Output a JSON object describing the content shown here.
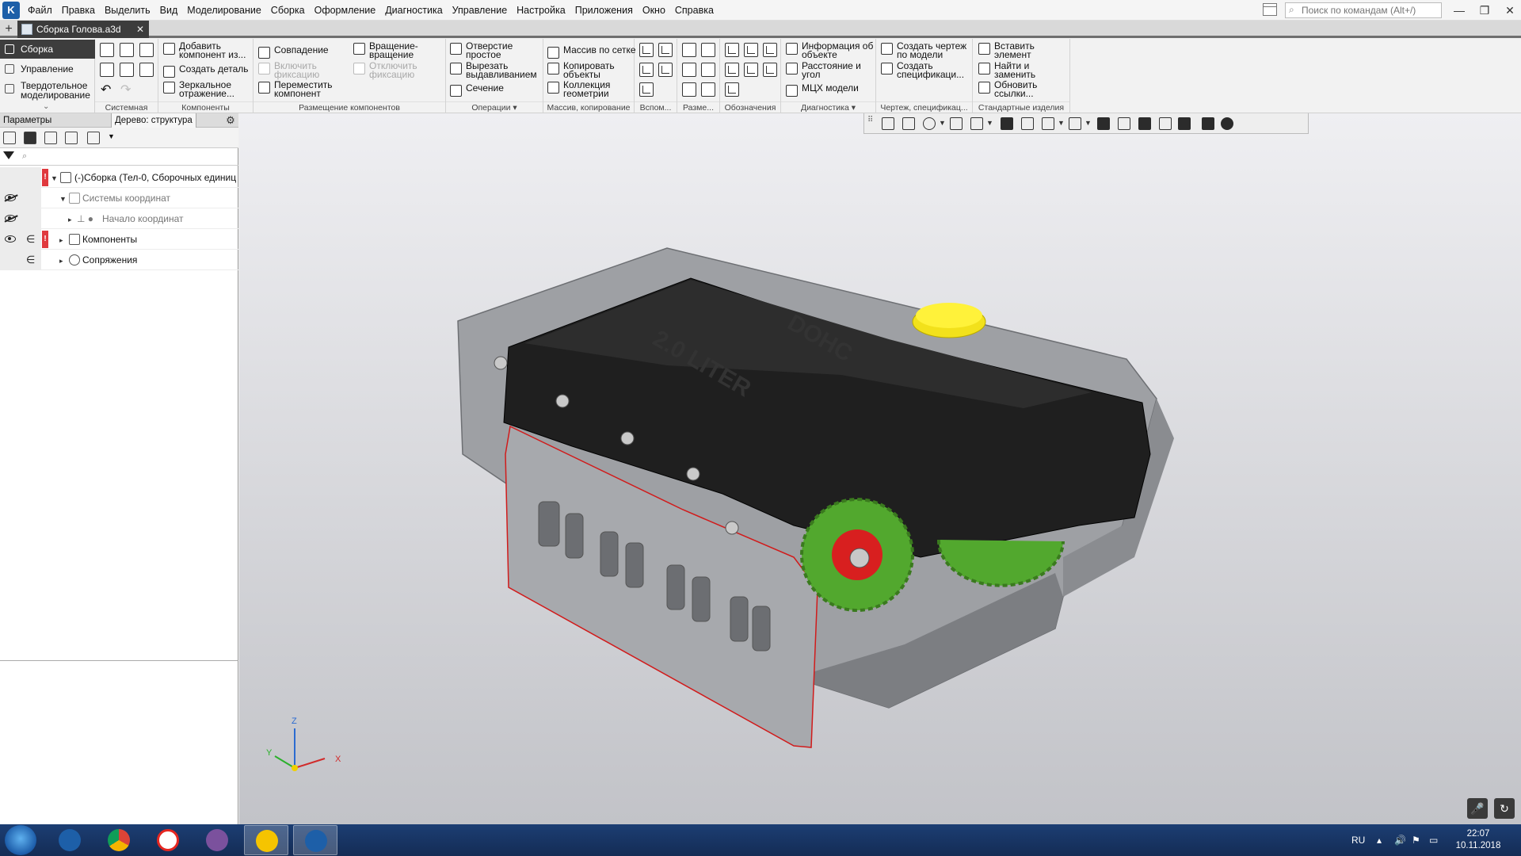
{
  "app": {
    "menu": [
      "Файл",
      "Правка",
      "Выделить",
      "Вид",
      "Моделирование",
      "Сборка",
      "Оформление",
      "Диагностика",
      "Управление",
      "Настройка",
      "Приложения",
      "Окно",
      "Справка"
    ],
    "search_placeholder": "Поиск по командам (Alt+/)"
  },
  "tabs": {
    "doc_title": "Сборка Голова.a3d"
  },
  "ribbon": {
    "modes": [
      "Сборка",
      "Управление",
      "Твердотельное моделирование"
    ],
    "groups": {
      "system": "Системная",
      "components": "Компоненты",
      "placement": "Размещение компонентов",
      "operations": "Операции",
      "array": "Массив, копирование",
      "aux": "Вспом...",
      "dims": "Разме...",
      "notation": "Обозначения",
      "diagnostics": "Диагностика",
      "drawing": "Чертеж, спецификац...",
      "standard": "Стандартные изделия"
    },
    "buttons": {
      "add_component": "Добавить компонент из...",
      "create_part": "Создать деталь",
      "mirror": "Зеркальное отражение...",
      "coincidence": "Совпадение",
      "enable_fix": "Включить фиксацию",
      "move_component": "Переместить компонент",
      "rotate_move": "Вращение-вращение",
      "disable_fix": "Отключить фиксацию",
      "simple_hole": "Отверстие простое",
      "cut_extrude": "Вырезать выдавливанием",
      "section": "Сечение",
      "grid_array": "Массив по сетке",
      "copy_objects": "Копировать объекты",
      "geom_collection": "Коллекция геометрии",
      "object_info": "Информация об объекте",
      "distance_angle": "Расстояние и угол",
      "mass_props": "МЦХ модели",
      "create_drawing": "Создать чертеж по модели",
      "create_spec": "Создать спецификаци...",
      "insert_element": "Вставить элемент",
      "find_replace": "Найти и заменить",
      "update_links": "Обновить ссылки..."
    }
  },
  "left_panel": {
    "tab_params": "Параметры",
    "tab_tree": "Дерево: структура",
    "tree": [
      {
        "label": "(-)Сборка (Тел-0, Сборочных единиц",
        "warn": "!"
      },
      {
        "label": "Системы координат"
      },
      {
        "label": "Начало координат"
      },
      {
        "label": "Компоненты",
        "warn": "!"
      },
      {
        "label": "Сопряжения"
      }
    ]
  },
  "model": {
    "cover_text_1": "DOHC",
    "cover_text_2": "2.0 LITER",
    "axes": {
      "x": "X",
      "y": "Y",
      "z": "Z"
    }
  },
  "taskbar": {
    "lang": "RU",
    "time": "22:07",
    "date": "10.11.2018"
  }
}
